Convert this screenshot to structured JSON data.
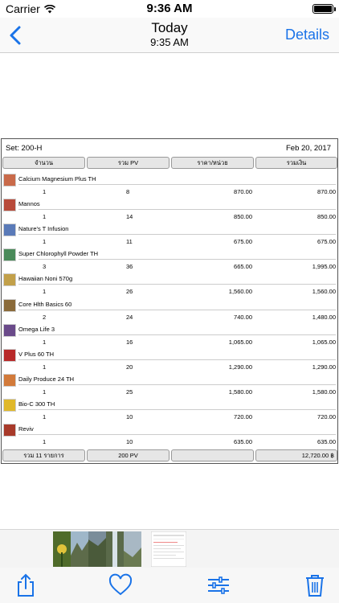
{
  "status_bar": {
    "carrier": "Carrier",
    "time": "9:36 AM"
  },
  "nav": {
    "title": "Today",
    "subtitle": "9:35 AM",
    "details_label": "Details"
  },
  "document": {
    "set_label": "Set: 200-H",
    "date": "Feb 20, 2017",
    "headers": [
      "จำนวน",
      "รวม PV",
      "ราคา/หน่วย",
      "รวมเงิน"
    ],
    "items": [
      {
        "name": "Calcium Magnesium Plus TH",
        "qty": "1",
        "pv": "8",
        "price": "870.00",
        "total": "870.00"
      },
      {
        "name": "Mannos",
        "qty": "1",
        "pv": "14",
        "price": "850.00",
        "total": "850.00"
      },
      {
        "name": "Nature's T Infusion",
        "qty": "1",
        "pv": "11",
        "price": "675.00",
        "total": "675.00"
      },
      {
        "name": "Super Chlorophyll Powder TH",
        "qty": "3",
        "pv": "36",
        "price": "665.00",
        "total": "1,995.00"
      },
      {
        "name": "Hawaiian Noni 570g",
        "qty": "1",
        "pv": "26",
        "price": "1,560.00",
        "total": "1,560.00"
      },
      {
        "name": "Core Hlth Basics 60",
        "qty": "2",
        "pv": "24",
        "price": "740.00",
        "total": "1,480.00"
      },
      {
        "name": "Omega Life 3",
        "qty": "1",
        "pv": "16",
        "price": "1,065.00",
        "total": "1,065.00"
      },
      {
        "name": "V Plus 60 TH",
        "qty": "1",
        "pv": "20",
        "price": "1,290.00",
        "total": "1,290.00"
      },
      {
        "name": "Daily Produce 24 TH",
        "qty": "1",
        "pv": "25",
        "price": "1,580.00",
        "total": "1,580.00"
      },
      {
        "name": "Bio-C 300 TH",
        "qty": "1",
        "pv": "10",
        "price": "720.00",
        "total": "720.00"
      },
      {
        "name": "Reviv",
        "qty": "1",
        "pv": "10",
        "price": "635.00",
        "total": "635.00"
      }
    ],
    "footer": {
      "count": "รวม 11 รายการ",
      "pv": "200 PV",
      "price": "",
      "total": "12,720.00 ฿"
    }
  },
  "colors": {
    "accent": "#1a73e8",
    "header_bg": "#e6e6e6"
  },
  "icons": [
    "back-chevron-icon",
    "share-icon",
    "heart-icon",
    "sliders-icon",
    "trash-icon"
  ]
}
